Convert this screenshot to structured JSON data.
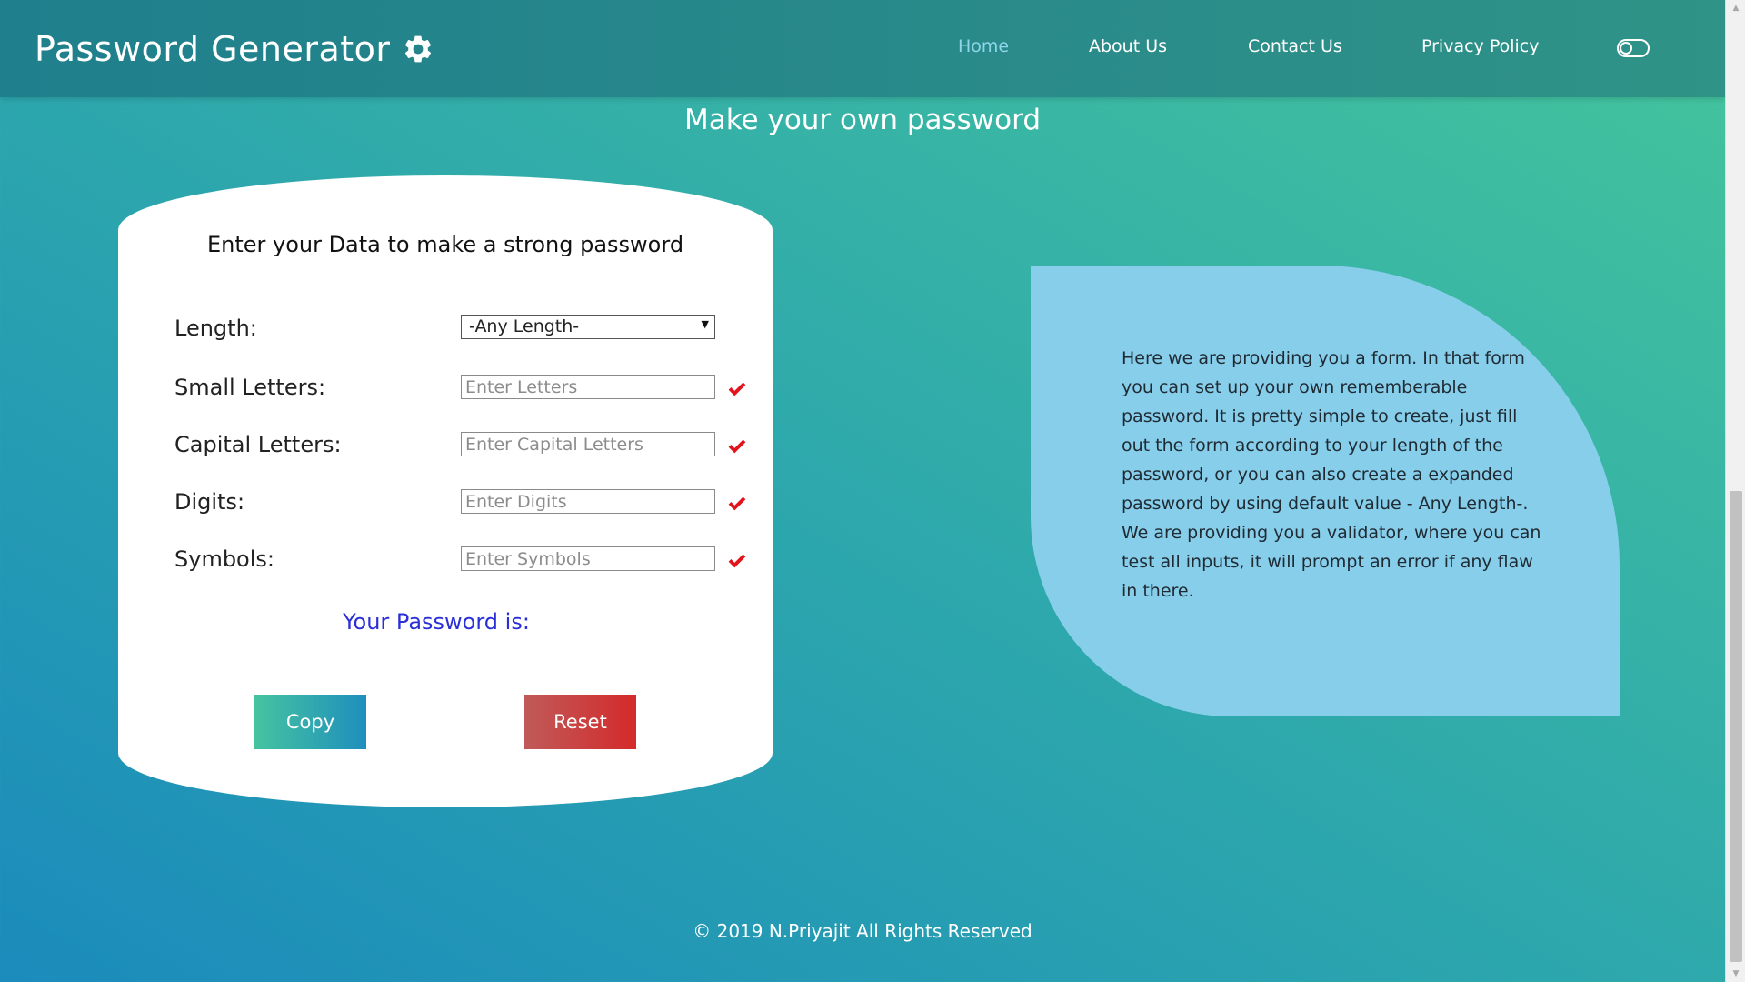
{
  "navbar": {
    "brand": "Password Generator",
    "brand_icon": "gear-icon",
    "links": [
      {
        "label": "Home",
        "active": true
      },
      {
        "label": "About Us",
        "active": false
      },
      {
        "label": "Contact Us",
        "active": false
      },
      {
        "label": "Privacy Policy",
        "active": false
      }
    ],
    "toggle_icon": "toggle-icon",
    "active_color": "#8fd6ea"
  },
  "page": {
    "title": "Make your own password"
  },
  "form": {
    "heading": "Enter your Data to make a strong password",
    "length": {
      "label": "Length:",
      "selected": "-Any Length-"
    },
    "small": {
      "label": "Small Letters:",
      "placeholder": "Enter Letters"
    },
    "capital": {
      "label": "Capital Letters:",
      "placeholder": "Enter Capital Letters"
    },
    "digits": {
      "label": "Digits:",
      "placeholder": "Enter Digits"
    },
    "symbols": {
      "label": "Symbols:",
      "placeholder": "Enter Symbols"
    },
    "check_color": "#e3131b",
    "result_label": "Your Password is:",
    "copy_button": "Copy",
    "reset_button": "Reset"
  },
  "info": {
    "text": "Here we are providing you a form. In that form you can set up your own rememberable password. It is pretty simple to create, just fill out the form according to your length of the password, or you can also create a expanded password by using default value - Any Length-. We are providing you a validator, where you can test all inputs, it will prompt an error if any flaw in there."
  },
  "footer": {
    "text": "© 2019 N.Priyajit All Rights Reserved"
  }
}
